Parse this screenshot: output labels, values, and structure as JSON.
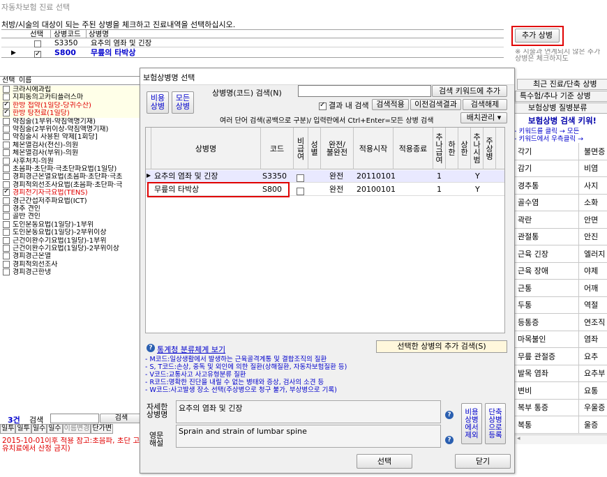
{
  "main": {
    "title": "자동차보험 진료 선택",
    "instruction": "처방/시술의 대상이 되는 주된 상병을 체크하고 진료내역을 선택하십시오.",
    "grid_headers": {
      "select": "선택",
      "code": "상병코드",
      "name": "상병명"
    },
    "grid_rows": [
      {
        "checked": false,
        "code": "S3350",
        "name": "요추의 염좌 및 긴장",
        "current": false
      },
      {
        "checked": true,
        "code": "S800",
        "name": "무릎의 타박상",
        "current": true
      }
    ],
    "add_button": "추가 상병",
    "note": "※ 시술과 연계되지 않은 추가 상병은 체크하지도"
  },
  "left_list": {
    "headers": {
      "select": "선택",
      "name": "이름"
    },
    "items": [
      {
        "text": "크라시에과립",
        "checked": false,
        "color": "#000000",
        "bg": "#ffffe8"
      },
      {
        "text": "지피동의고카티플러스마",
        "checked": false,
        "color": "#000000",
        "bg": "#ffffe8"
      },
      {
        "text": "한방 첩약(1일당-당귀수산)",
        "checked": true,
        "color": "#e00000",
        "bg": "#ffffe8"
      },
      {
        "text": "한방 탕전료(1일당)",
        "checked": true,
        "color": "#e00000",
        "bg": "#ffffe8"
      },
      {
        "text": "약침술(1부위-약침액명기재)",
        "checked": false,
        "color": "#000000",
        "bg": "#ffffff"
      },
      {
        "text": "약침술(2부위이상-약침액명기재)",
        "checked": false,
        "color": "#000000",
        "bg": "#ffffff"
      },
      {
        "text": "약침술시 사용된 약제[1회당]",
        "checked": false,
        "color": "#000000",
        "bg": "#ffffff"
      },
      {
        "text": "체온열검사(전신)-의원",
        "checked": false,
        "color": "#000000",
        "bg": "#ffffff"
      },
      {
        "text": "체온열검사(부위)-의원",
        "checked": false,
        "color": "#000000",
        "bg": "#ffffff"
      },
      {
        "text": "사후처치-의원",
        "checked": false,
        "color": "#000000",
        "bg": "#ffffff"
      },
      {
        "text": "초음파·초단파·극초단파요법(1일당)",
        "checked": false,
        "color": "#000000",
        "bg": "#ffffff"
      },
      {
        "text": "경피경근온열요법(초음파·초단파·극초",
        "checked": false,
        "color": "#000000",
        "bg": "#ffffff"
      },
      {
        "text": "경피적외선조사요법(초음파·초단파·극",
        "checked": false,
        "color": "#000000",
        "bg": "#ffffff"
      },
      {
        "text": "경피전기자극요법(TENS)",
        "checked": true,
        "color": "#e00000",
        "bg": "#ffffff"
      },
      {
        "text": "경근간섭저주파요법(ICT)",
        "checked": false,
        "color": "#000000",
        "bg": "#ffffff"
      },
      {
        "text": "경추 견인",
        "checked": false,
        "color": "#000000",
        "bg": "#ffffff"
      },
      {
        "text": "골반 견인",
        "checked": false,
        "color": "#000000",
        "bg": "#ffffff"
      },
      {
        "text": "도인운동요법(1일당)-1부위",
        "checked": false,
        "color": "#000000",
        "bg": "#ffffff"
      },
      {
        "text": "도인운동요법(1일당)-2부위이상",
        "checked": false,
        "color": "#000000",
        "bg": "#ffffff"
      },
      {
        "text": "근건이완수기요법(1일당)-1부위",
        "checked": false,
        "color": "#000000",
        "bg": "#ffffff"
      },
      {
        "text": "근건이완수기요법(1일당)-2부위이상",
        "checked": false,
        "color": "#000000",
        "bg": "#ffffff"
      },
      {
        "text": "경피경근온열",
        "checked": false,
        "color": "#000000",
        "bg": "#ffffff"
      },
      {
        "text": "경피적외선조사",
        "checked": false,
        "color": "#000000",
        "bg": "#ffffff"
      },
      {
        "text": "경피경근한냉",
        "checked": false,
        "color": "#000000",
        "bg": "#ffffff"
      }
    ],
    "count": "3건",
    "search_label": "검색",
    "search_button": "검색",
    "bottom_tabs": [
      "일투",
      "일투",
      "일수",
      "일수",
      "이름변경",
      "단가변"
    ],
    "warning": "2015-10-01이후 적용 참고:초음파, 초단 고유치료에서 산정 금지)"
  },
  "dialog": {
    "title": "보험상병명 선택",
    "btn_nonins": "비용\n상병",
    "btn_all": "모든\n상병",
    "search_label": "상병명(코드) 검색(N)",
    "search_value": "",
    "add_keyword_button": "검색 키워드에 추가",
    "within_label": "결과 내 검색",
    "within_checked": true,
    "apply_button": "검색적용",
    "prev_button": "이전검색결과",
    "clear_button": "검색해제",
    "help_text": "여러 단어 검색(공백으로 구분)/ 입력란에서 Ctrl+Enter=모든 상병 검색",
    "layout_button": "배치관리 ▾",
    "table_headers": {
      "name": "상병명",
      "code": "코드",
      "nonpay": "비\n급\n여",
      "sex": "성\n별",
      "complete": "완전/\n불완전",
      "start": "적용시작",
      "end": "적용종료",
      "add_nonpay": "추\n나\n급\n여",
      "lower": "하\n한",
      "upper": "상\n한",
      "chuna": "추\n나\n시\n범",
      "main": "주\n상\n병"
    },
    "rows": [
      {
        "name": "요추의 염좌 및 긴장",
        "code": "S3350",
        "complete": "완전",
        "start": "20110101",
        "end": "",
        "lower": "1",
        "chuna": "Y"
      },
      {
        "name": "무릎의 타박상",
        "code": "S800",
        "complete": "완전",
        "start": "20100101",
        "end": "",
        "lower": "1",
        "chuna": "Y"
      }
    ],
    "stats_link": "통계청 분류체계 보기",
    "add_search_button": "선택한 상병의 추가 검색(S)",
    "info_lines": [
      "- M코드:일상생활에서 발생하는 근육골격계통 및 결합조직의 질환",
      "- S, T코드:손상, 중독 및 외인에 의한 질환(상해질환, 자동차보험질환 등)",
      "- V코드:교통사고 사고유형분류 질환",
      "- R코드:명확한 진단을 내릴 수 없는 병태와 증상, 검사의 소견 등",
      "- W코드:사고발생 장소 선택(주상병으로 청구 불가, 부상병으로 기록)"
    ],
    "detail_label": "자세한\n상병명",
    "detail_value": "요추의 염좌 및 긴장",
    "english_label": "영문\n해설",
    "english_value": "Sprain and strain of lumbar spine",
    "exclude_button": "비용\n상병\n에서\n제외",
    "register_button": "단축\n상병\n으로\n등록",
    "select_button": "선택",
    "close_button": "닫기"
  },
  "right_panel": {
    "tabs": [
      "최근 진료/단축 상병",
      "특수험/추나 기준 상병",
      "보험상병 질병분류"
    ],
    "heading": "보험상병 검색 키워!",
    "hint1": "- 키워드를 클릭 → 모든",
    "hint2": "- 키워드에서 우측클릭 →",
    "keywords": [
      [
        "각기",
        "불면증"
      ],
      [
        "감기",
        "비염"
      ],
      [
        "경추통",
        "사지"
      ],
      [
        "골수염",
        "소화"
      ],
      [
        "곽란",
        "안면"
      ],
      [
        "관절통",
        "안진"
      ],
      [
        "근육 긴장",
        "엘러지"
      ],
      [
        "근육 장애",
        "야제"
      ],
      [
        "근통",
        "어깨"
      ],
      [
        "두통",
        "역절"
      ],
      [
        "등통증",
        "연조직"
      ],
      [
        "마목불인",
        "염좌"
      ],
      [
        "무릎 관절증",
        "요추"
      ],
      [
        "발목 염좌",
        "요추부"
      ],
      [
        "변비",
        "요통"
      ],
      [
        "복부 통증",
        "우울증"
      ],
      [
        "복통",
        "울증"
      ]
    ],
    "scroll_left": "◂"
  },
  "colors": {
    "highlight_red": "#e00000",
    "link_blue": "#0000cc",
    "selected_row": "#e9e9ff",
    "keyword_heading": "#0000aa"
  }
}
